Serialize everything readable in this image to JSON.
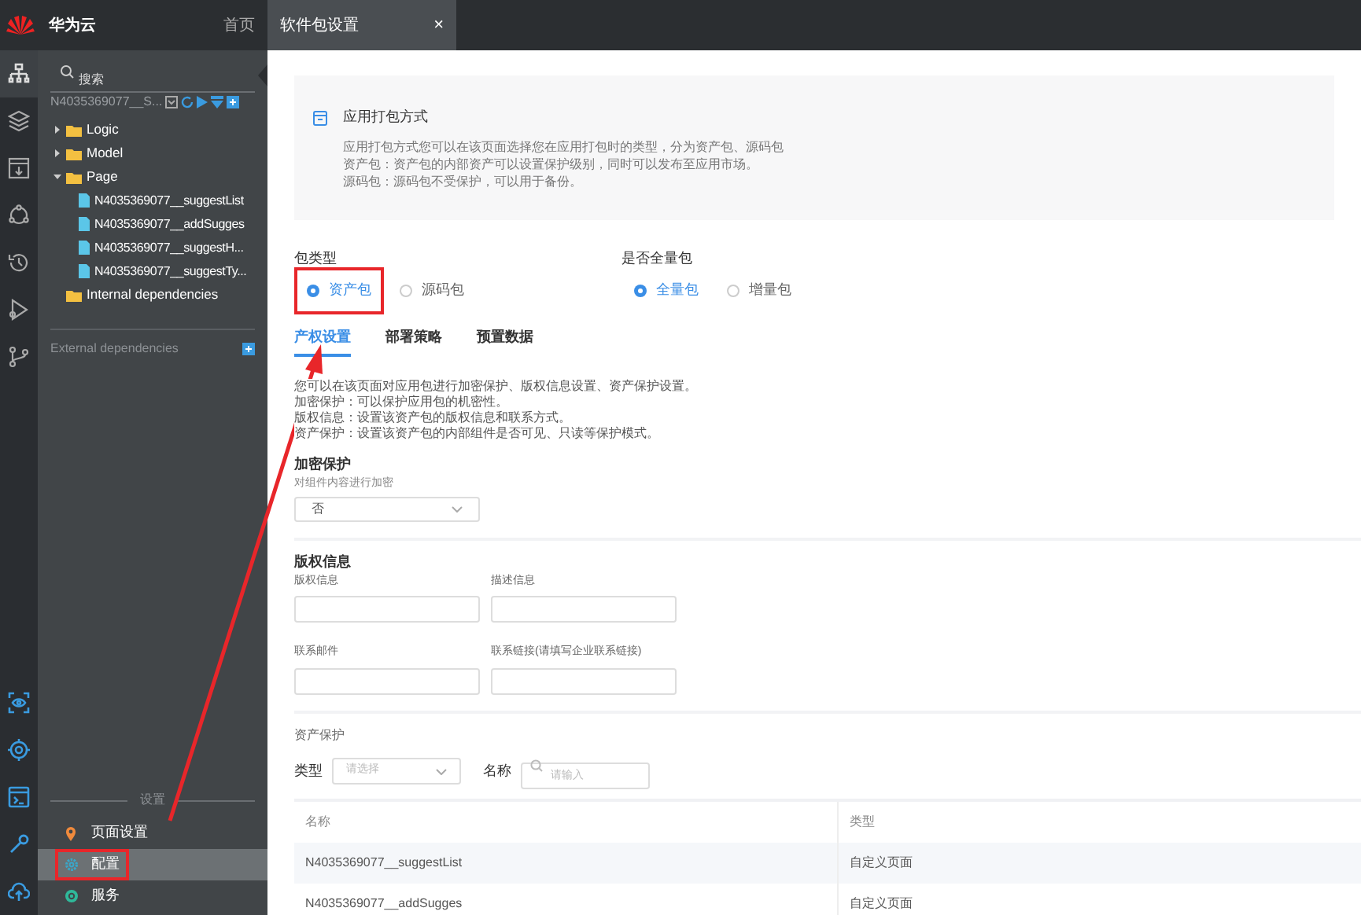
{
  "header": {
    "brand": "华为云",
    "home": "首页",
    "tabs": [
      {
        "label": "软件包设置",
        "selected": true,
        "close": "×"
      }
    ]
  },
  "activity_bar": {
    "top": [
      {
        "selected": true
      },
      {
        "selected": false
      },
      {
        "selected": false
      },
      {
        "selected": false
      },
      {
        "selected": false
      },
      {
        "selected": false
      },
      {
        "selected": false
      }
    ],
    "bottom": [
      {
        "selected": false
      },
      {
        "selected": false
      },
      {
        "selected": false
      },
      {
        "selected": false
      },
      {
        "selected": false
      }
    ]
  },
  "explorer": {
    "search": {
      "placeholder": "搜索"
    },
    "project": "N4035369077__S...",
    "tree": [
      {
        "label": "Logic",
        "expanded": false
      },
      {
        "label": "Model",
        "expanded": false
      },
      {
        "label": "Page",
        "expanded": true,
        "children": [
          {
            "label": "N4035369077__suggestList"
          },
          {
            "label": "N4035369077__addSugges"
          },
          {
            "label": "N4035369077__suggestH..."
          },
          {
            "label": "N4035369077__suggestTy..."
          }
        ]
      },
      {
        "label": "Internal dependencies"
      }
    ],
    "external": "External dependencies",
    "settings_heading": "设置",
    "settings": [
      {
        "label": "页面设置",
        "selected": false,
        "annotated": false
      },
      {
        "label": "配置",
        "selected": true,
        "annotated": true
      },
      {
        "label": "服务",
        "selected": false,
        "annotated": false
      }
    ]
  },
  "info": {
    "title": "应用打包方式",
    "lines": [
      "应用打包方式您可以在该页面选择您在应用打包时的类型，分为资产包、源码包",
      "资产包：资产包的内部资产可以设置保护级别，同时可以发布至应用市场。",
      "源码包：源码包不受保护，可以用于备份。"
    ]
  },
  "options": [
    {
      "label": "包类型",
      "choices": [
        {
          "label": "资产包",
          "selected": true,
          "annotated": true
        },
        {
          "label": "源码包",
          "selected": false,
          "annotated": false
        }
      ]
    },
    {
      "label": "是否全量包",
      "choices": [
        {
          "label": "全量包",
          "selected": true,
          "annotated": false
        },
        {
          "label": "增量包",
          "selected": false,
          "annotated": false
        }
      ]
    }
  ],
  "tabs": [
    {
      "label": "产权设置",
      "selected": true
    },
    {
      "label": "部署策略",
      "selected": false
    },
    {
      "label": "预置数据",
      "selected": false
    }
  ],
  "description": [
    "您可以在该页面对应用包进行加密保护、版权信息设置、资产保护设置。",
    "加密保护：可以保护应用包的机密性。",
    "版权信息：设置该资产包的版权信息和联系方式。",
    "资产保护：设置该资产包的内部组件是否可见、只读等保护模式。"
  ],
  "encryption": {
    "title": "加密保护",
    "hint": "对组件内容进行加密",
    "value": "否"
  },
  "copyright": {
    "title": "版权信息",
    "fields": [
      {
        "label": "版权信息"
      },
      {
        "label": "描述信息"
      },
      {
        "label": "联系邮件"
      },
      {
        "label": "联系链接(请填写企业联系链接)"
      }
    ]
  },
  "assets": {
    "title": "资产保护",
    "type_label": "类型",
    "type_placeholder": "请选择",
    "name_label": "名称",
    "name_placeholder": "请输入",
    "table": {
      "columns": [
        "名称",
        "类型"
      ],
      "rows": [
        [
          "N4035369077__suggestList",
          "自定义页面"
        ],
        [
          "N4035369077__addSugges",
          "自定义页面"
        ]
      ]
    }
  },
  "annotation_arrow": true
}
